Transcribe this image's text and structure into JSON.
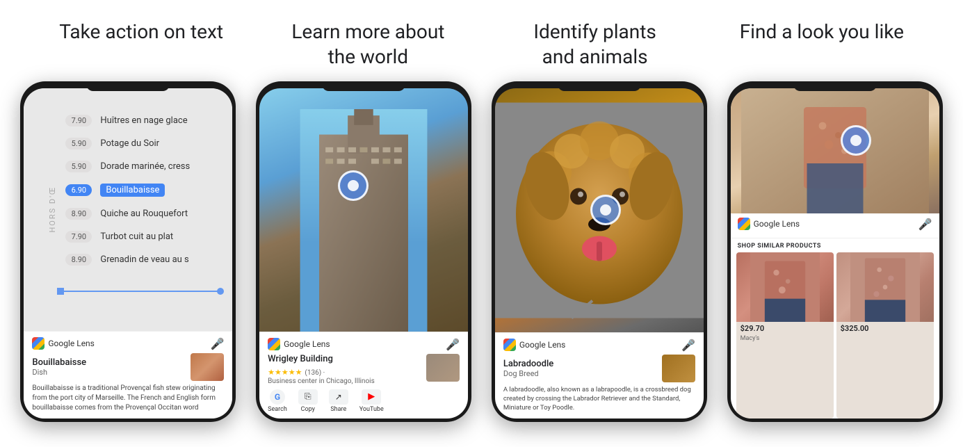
{
  "headers": {
    "phone1_title": "Take action on text",
    "phone2_title": "Learn more about\nthe world",
    "phone3_title": "Identify plants\nand animals",
    "phone4_title": "Find a look you like"
  },
  "phone1": {
    "menu_items": [
      {
        "price": "7.90",
        "name": "Huîtres en nage glace"
      },
      {
        "price": "5.90",
        "name": "Potage du Soir"
      },
      {
        "price": "5.90",
        "name": "Dorade marinée, cress"
      },
      {
        "price": "6.90",
        "name": "Bouillabaisse",
        "selected": true
      },
      {
        "price": "8.90",
        "name": "Quiche au Rouquefort"
      },
      {
        "price": "7.90",
        "name": "Turbot cuit au plat"
      },
      {
        "price": "8.90",
        "name": "Grenadin de veau au s"
      }
    ],
    "lens_label": "Google Lens",
    "result_title": "Bouillabaisse",
    "result_sub": "Dish",
    "description": "Bouillabaisse is a traditional Provençal fish stew originating from the port city of Marseille. The French and English form bouillabaisse comes from the Provençal Occitan word"
  },
  "phone2": {
    "lens_label": "Google Lens",
    "result_title": "Wrigley Building",
    "result_sub": "Business center in Chicago, Illinois",
    "stars": "★★★★★",
    "rating_count": "(136) ·",
    "actions": [
      "Search",
      "Copy",
      "Share",
      "YouTube"
    ],
    "description": ""
  },
  "phone3": {
    "lens_label": "Google Lens",
    "result_title": "Labradoodle",
    "result_sub": "Dog Breed",
    "description": "A labradoodle, also known as a labrapoodle, is a crossbreed dog created by crossing the Labrador Retriever and the Standard, Miniature or Toy Poodle."
  },
  "phone4": {
    "lens_label": "Google Lens",
    "shop_similar": "SHOP SIMILAR PRODUCTS",
    "item1_price": "$29.70",
    "item1_store": "Macy's",
    "item2_price": "$325.00",
    "item2_store": ""
  }
}
